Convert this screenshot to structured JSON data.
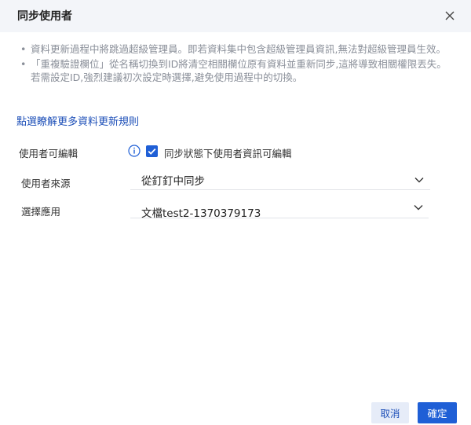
{
  "dialog": {
    "title": "同步使用者",
    "close_icon": "close-icon"
  },
  "notes": [
    "資料更新過程中將跳過超級管理員。即若資料集中包含超級管理員資訊,無法對超級管理員生效。",
    "「重複驗證欄位」從名稱切換到ID將清空相關欄位原有資料並重新同步,這將導致相關權限丟失。若需設定ID,強烈建議初次設定時選擇,避免使用過程中的切換。"
  ],
  "note_bullet": "•",
  "rules_link": "點選瞭解更多資料更新規則",
  "form": {
    "editable": {
      "label": "使用者可編輯",
      "info_icon": "info-icon",
      "checked": true,
      "checkbox_label": "同步狀態下使用者資訊可編輯"
    },
    "source": {
      "label": "使用者來源",
      "value": "從釘釘中同步"
    },
    "app": {
      "label": "選擇應用",
      "value": "文檔test2-1370379173"
    }
  },
  "footer": {
    "cancel_label": "取消",
    "ok_label": "確定"
  },
  "colors": {
    "accent": "#1f5fd6",
    "link": "#1d4fb8",
    "header_bg": "#f3f5f9",
    "note_text": "#8a8f99"
  }
}
